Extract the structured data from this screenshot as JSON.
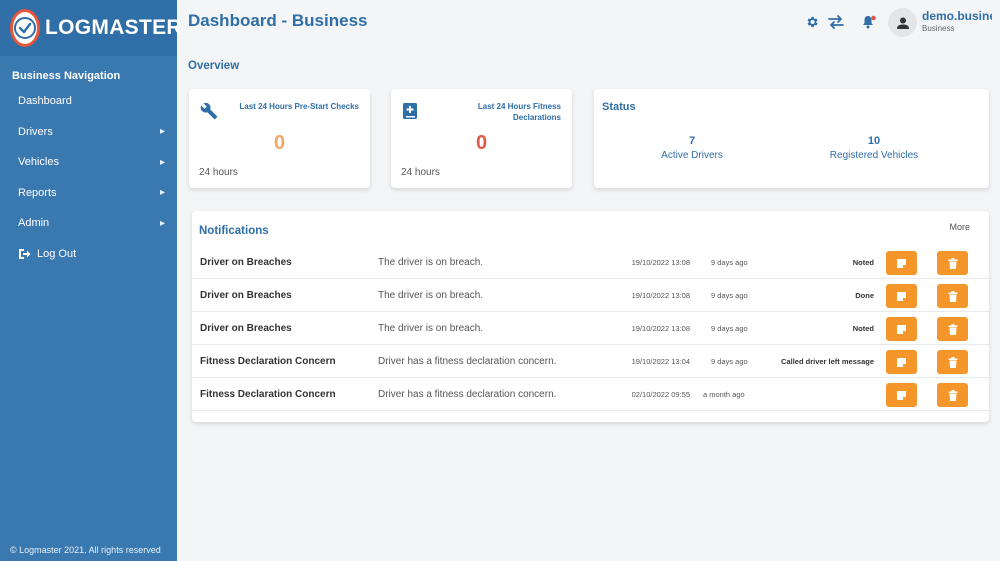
{
  "sidebar": {
    "brand": "LOGMASTER",
    "heading": "Business Navigation",
    "items": [
      {
        "label": "Dashboard",
        "chevron": false
      },
      {
        "label": "Drivers",
        "chevron": true
      },
      {
        "label": "Vehicles",
        "chevron": true
      },
      {
        "label": "Reports",
        "chevron": true
      },
      {
        "label": "Admin",
        "chevron": true
      },
      {
        "label": "Log Out",
        "chevron": false
      }
    ],
    "footer": "© Logmaster 2021. All rights reserved"
  },
  "header": {
    "title": "Dashboard - Business",
    "user_name": "demo.business",
    "user_role": "Business"
  },
  "overview": {
    "title": "Overview",
    "cards": [
      {
        "title": "Last 24 Hours Pre-Start Checks",
        "value": "0",
        "sub": "24 hours",
        "icon": "wrench-icon",
        "color": "#f0a868"
      },
      {
        "title": "Last 24 Hours Fitness Declarations",
        "value": "0",
        "sub": "24 hours",
        "icon": "medical-book-icon",
        "color": "#e05a4a"
      }
    ],
    "status": {
      "title": "Status",
      "active_drivers_value": "7",
      "active_drivers_label": "Active Drivers",
      "registered_vehicles_value": "10",
      "registered_vehicles_label": "Registered Vehicles"
    }
  },
  "notifications": {
    "title": "Notifications",
    "more": "More",
    "rows": [
      {
        "title": "Driver on Breaches",
        "message": "The driver is on breach.",
        "date": "19/10/2022 13:08",
        "ago": "9 days ago",
        "status": "Noted"
      },
      {
        "title": "Driver on Breaches",
        "message": "The driver is on breach.",
        "date": "19/10/2022 13:08",
        "ago": "9 days ago",
        "status": "Done"
      },
      {
        "title": "Driver on Breaches",
        "message": "The driver is on breach.",
        "date": "19/10/2022 13:08",
        "ago": "9 days ago",
        "status": "Noted"
      },
      {
        "title": "Fitness Declaration Concern",
        "message": "Driver has a fitness declaration concern.",
        "date": "19/10/2022 13:04",
        "ago": "9 days ago",
        "status": "Called driver left message"
      },
      {
        "title": "Fitness Declaration Concern",
        "message": "Driver has a fitness declaration concern.",
        "date": "02/10/2022 09:55",
        "ago": "a month ago",
        "status": ""
      }
    ]
  },
  "colors": {
    "sidebar": "#3a78b0",
    "brand_bar": "#2f6ea6",
    "accent": "#2f6ea6",
    "button": "#f4962a",
    "notification_dot": "#e05a4a"
  }
}
